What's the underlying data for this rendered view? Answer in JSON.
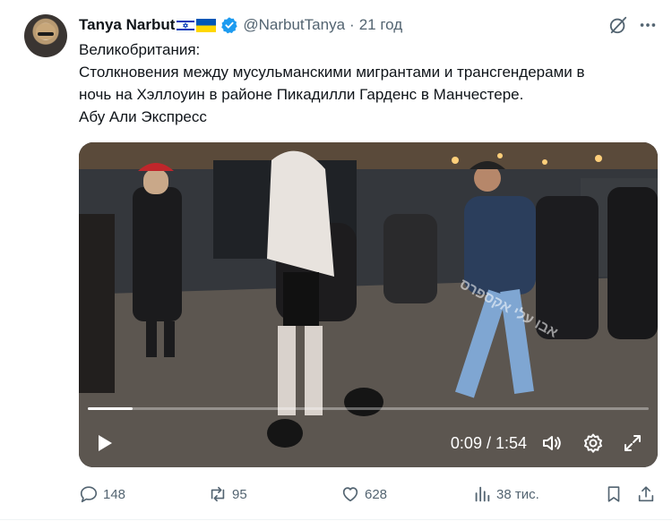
{
  "author": {
    "name": "Tanya Narbut",
    "flag_il": "🇮🇱",
    "flag_ua": "🇺🇦",
    "handle": "@NarbutTanya",
    "separator": "·",
    "time": "21 год"
  },
  "text_lines": [
    "Великобритания:",
    "Столкновения между мусульманскими мигрантами и трансгендерами в",
    "ночь на Хэллоуин в районе Пикадилли Гарденс в Манчестере.",
    "Абу Али Экспресс"
  ],
  "video": {
    "timecode": "0:09 / 1:54",
    "progress_fraction": 0.08,
    "watermark": "אבו עלי אקספרס"
  },
  "actions": {
    "replies": "148",
    "reposts": "95",
    "likes": "628",
    "views": "38 тис."
  },
  "colors": {
    "text": "#0f1419",
    "muted": "#536471",
    "verified": "#1d9bf0"
  },
  "icons": {
    "verified": "verified-badge-icon",
    "grok": "grok-icon",
    "more": "more-icon",
    "play": "play-icon",
    "volume": "volume-icon",
    "settings": "settings-icon",
    "fullscreen": "fullscreen-icon",
    "reply": "reply-icon",
    "repost": "repost-icon",
    "like": "like-icon",
    "views": "views-icon",
    "bookmark": "bookmark-icon",
    "share": "share-icon"
  }
}
